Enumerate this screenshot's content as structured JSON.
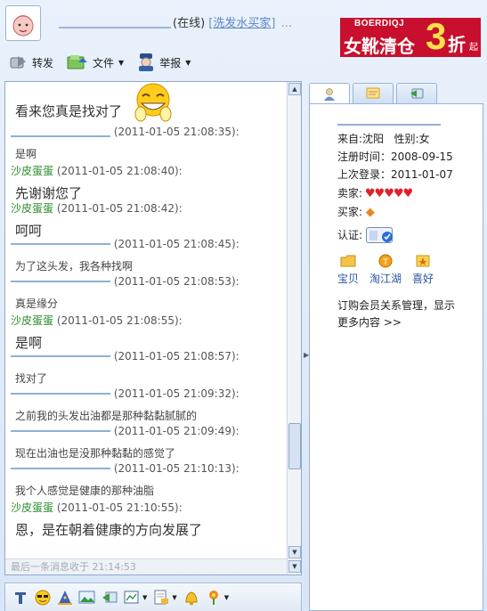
{
  "header": {
    "nickname_masked": "x",
    "status": "(在线)",
    "separator_left": "[",
    "link": "洗发水买家",
    "separator_right": "]",
    "dots": "..."
  },
  "ad": {
    "brand": "BOERDIQJ",
    "sale": "女靴清仓",
    "discount": "3",
    "zhe": "折",
    "qi": "起"
  },
  "toolbar": {
    "forward": "转发",
    "file": "文件",
    "report": "举报"
  },
  "messages": [
    {
      "type": "body",
      "text": "看来您真是找对了",
      "size": "big"
    },
    {
      "type": "head",
      "sender": "x",
      "masked": true,
      "time": "(2011-01-05 21:08:35):"
    },
    {
      "type": "body",
      "text": "是啊",
      "size": "small"
    },
    {
      "type": "head",
      "sender": "沙皮蛋蛋",
      "masked": false,
      "time": "(2011-01-05 21:08:40):"
    },
    {
      "type": "body",
      "text": "先谢谢您了",
      "size": "big"
    },
    {
      "type": "head",
      "sender": "沙皮蛋蛋",
      "masked": false,
      "time": "(2011-01-05 21:08:42):"
    },
    {
      "type": "body",
      "text": "呵呵",
      "size": "big"
    },
    {
      "type": "head",
      "sender": "",
      "masked": true,
      "time": "(2011-01-05 21:08:45):"
    },
    {
      "type": "body",
      "text": "为了这头发，我各种找啊",
      "size": "small"
    },
    {
      "type": "head",
      "sender": "",
      "masked": true,
      "time": "(2011-01-05 21:08:53):"
    },
    {
      "type": "body",
      "text": "真是缘分",
      "size": "small"
    },
    {
      "type": "head",
      "sender": "沙皮蛋蛋",
      "masked": false,
      "time": "(2011-01-05 21:08:55):"
    },
    {
      "type": "body",
      "text": "是啊",
      "size": "big"
    },
    {
      "type": "head",
      "sender": "",
      "masked": true,
      "time": "(2011-01-05 21:08:57):"
    },
    {
      "type": "body",
      "text": "找对了",
      "size": "small"
    },
    {
      "type": "head",
      "sender": "",
      "masked": true,
      "time": "(2011-01-05 21:09:32):"
    },
    {
      "type": "body",
      "text": "之前我的头发出油都是那种黏黏腻腻的",
      "size": "small"
    },
    {
      "type": "head",
      "sender": "",
      "masked": true,
      "time": "(2011-01-05 21:09:49):"
    },
    {
      "type": "body",
      "text": "现在出油也是没那种黏黏的感觉了",
      "size": "small"
    },
    {
      "type": "head",
      "sender": "",
      "masked": true,
      "time": "(2011-01-05 21:10:13):"
    },
    {
      "type": "body",
      "text": "我个人感觉是健康的那种油脂",
      "size": "small"
    },
    {
      "type": "head",
      "sender": "沙皮蛋蛋",
      "masked": false,
      "time": "(2011-01-05 21:10:55):"
    },
    {
      "type": "body",
      "text": "恩，是在朝着健康的方向发展了",
      "size": "big"
    }
  ],
  "statusbar": "最后一条消息收于 21:14:53",
  "profile": {
    "name_masked": "x",
    "from_label": "来自:",
    "from": "沈阳",
    "gender_label": "性别:",
    "gender": "女",
    "register_label": "注册时间：",
    "register": "2008-09-15",
    "last_login_label": "上次登录：",
    "last_login": "2011-01-07",
    "seller_label": "卖家:",
    "buyer_label": "买家:",
    "cert_label": "认证:",
    "icons": [
      "宝贝",
      "淘江湖",
      "喜好"
    ],
    "promo_line1": "订购会员关系管理，显示",
    "promo_line2": "更多内容 >>"
  },
  "colors": {
    "accent": "#2855a5",
    "sender_green": "#2a8a2a",
    "ad_red": "#c8102e",
    "ad_yellow": "#ffe24a"
  }
}
